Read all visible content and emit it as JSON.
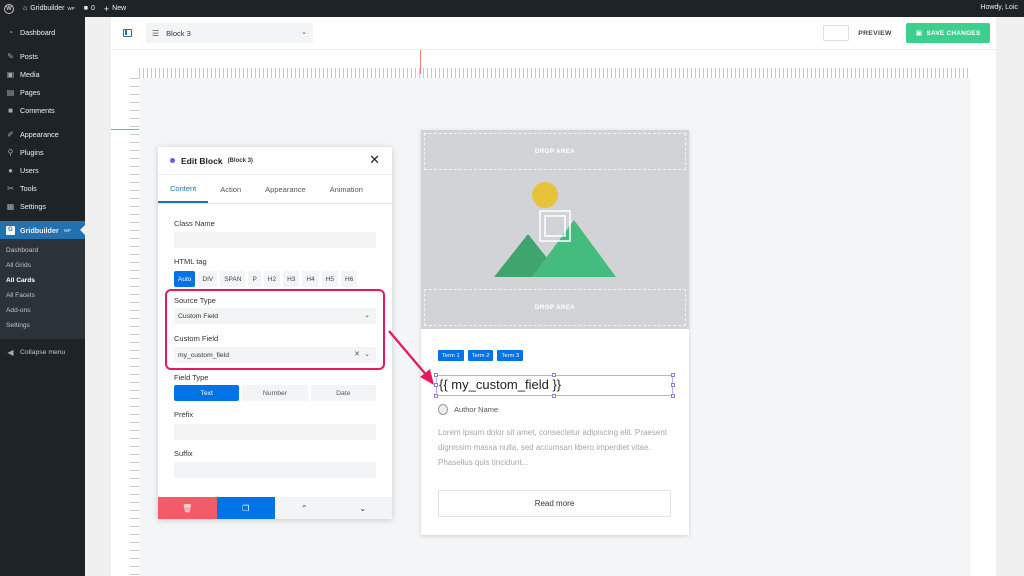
{
  "admin_bar": {
    "site_name": "Gridbuilder",
    "site_badge": "WP",
    "comments_count": "0",
    "new_label": "New",
    "howdy": "Howdy, Loic"
  },
  "sidebar": {
    "items": [
      {
        "label": "Dashboard",
        "icon": "dashboard-icon"
      },
      {
        "label": "Posts",
        "icon": "pin-icon"
      },
      {
        "label": "Media",
        "icon": "media-icon"
      },
      {
        "label": "Pages",
        "icon": "page-icon"
      },
      {
        "label": "Comments",
        "icon": "comment-icon"
      },
      {
        "label": "Appearance",
        "icon": "brush-icon"
      },
      {
        "label": "Plugins",
        "icon": "plugin-icon"
      },
      {
        "label": "Users",
        "icon": "user-icon"
      },
      {
        "label": "Tools",
        "icon": "wrench-icon"
      },
      {
        "label": "Settings",
        "icon": "settings-icon"
      }
    ],
    "active": {
      "label": "Gridbuilder",
      "badge": "WP"
    },
    "submenu": [
      "Dashboard",
      "All Grids",
      "All Cards",
      "All Facets",
      "Add-ons",
      "Settings"
    ],
    "submenu_current": "All Cards",
    "collapse": "Collapse menu"
  },
  "toolbar": {
    "block_select": "Block 3",
    "preview": "PREVIEW",
    "save": "SAVE CHANGES",
    "save_color": "#3ccf8e"
  },
  "panel": {
    "title": "Edit Block",
    "subtitle": "(Block 3)",
    "tabs": [
      "Content",
      "Action",
      "Appearance",
      "Animation"
    ],
    "active_tab": "Content",
    "class_name_label": "Class Name",
    "class_name_value": "",
    "html_tag_label": "HTML tag",
    "html_tags": [
      "Auto",
      "DIV",
      "SPAN",
      "P",
      "H2",
      "H3",
      "H4",
      "H5",
      "H6"
    ],
    "html_tag_selected": "Auto",
    "source_type_label": "Source Type",
    "source_type_value": "Custom Field",
    "custom_field_label": "Custom Field",
    "custom_field_value": "my_custom_field",
    "field_type_label": "Field Type",
    "field_types": [
      "Text",
      "Number",
      "Date"
    ],
    "field_type_selected": "Text",
    "prefix_label": "Prefix",
    "prefix_value": "",
    "suffix_label": "Suffix",
    "suffix_value": "",
    "accent_color": "#0073e6",
    "highlight_color": "#e6195e",
    "delete_color": "#f45b69"
  },
  "card": {
    "drop_area_top": "DROP AREA",
    "drop_area_bottom": "DROP AREA",
    "terms": [
      "Term 1",
      "Term 2",
      "Term 3"
    ],
    "custom_field_text": "{{ my_custom_field }}",
    "author": "Author Name",
    "excerpt": "Lorem ipsum dolor sit amet, consectetur adipiscing elit. Praesent dignissim massa nulla, sed accumsan libero imperdiet vitae. Phasellus quis tincidunt...",
    "read_more": "Read more"
  }
}
